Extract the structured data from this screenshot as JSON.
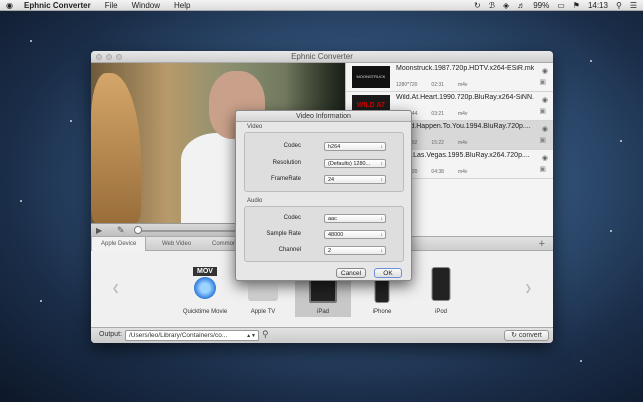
{
  "menubar": {
    "app_name": "Ephnic Converter",
    "menus": [
      "File",
      "Window",
      "Help"
    ],
    "battery": "99%",
    "time": "14:13"
  },
  "window": {
    "title": "Ephnic Converter"
  },
  "files": [
    {
      "name": "Moonstruck.1987.720p.HDTV.x264-ESiR.mkv",
      "resolution": "1280*720",
      "duration": "02:31",
      "format": "m4v",
      "selected": false
    },
    {
      "name": "Wild.At.Heart.1990.720p.BluRay.x264-SiNN...",
      "resolution": "1280*544",
      "duration": "03:21",
      "format": "m4v",
      "selected": false
    },
    {
      "name": "Could.Happen.To.You.1994.BluRay.720p....",
      "resolution": "1280*692",
      "duration": "15:22",
      "format": "m4v",
      "selected": true
    },
    {
      "name": "...ing.Las.Vegas.1995.BluRay.x264.720p....",
      "resolution": "1280*720",
      "duration": "04:38",
      "format": "m4v",
      "selected": false
    }
  ],
  "thumbnails": [
    "MOONSTRUCK",
    "WILD AT HEART",
    "",
    ""
  ],
  "tabs": [
    "Apple Device",
    "Web Video",
    "Common"
  ],
  "devices": [
    {
      "label": "Quicktime Movie",
      "badge": "MOV"
    },
    {
      "label": "Apple TV"
    },
    {
      "label": "iPad"
    },
    {
      "label": "iPhone"
    },
    {
      "label": "iPod"
    }
  ],
  "bottom": {
    "output_label": "Output:",
    "output_path": "/Users/leo/Library/Containers/co...",
    "convert_label": "convert"
  },
  "dialog": {
    "title": "Video Information",
    "video_group": "Video",
    "audio_group": "Audio",
    "video_rows": [
      {
        "label": "Codec",
        "value": "h264"
      },
      {
        "label": "Resolution",
        "value": "(Defaults) 1280..."
      },
      {
        "label": "FrameRate",
        "value": "24"
      }
    ],
    "audio_rows": [
      {
        "label": "Codec",
        "value": "aac"
      },
      {
        "label": "Sample Rate",
        "value": "48000"
      },
      {
        "label": "Channel",
        "value": "2"
      }
    ],
    "cancel_label": "Cancel",
    "ok_label": "OK"
  }
}
